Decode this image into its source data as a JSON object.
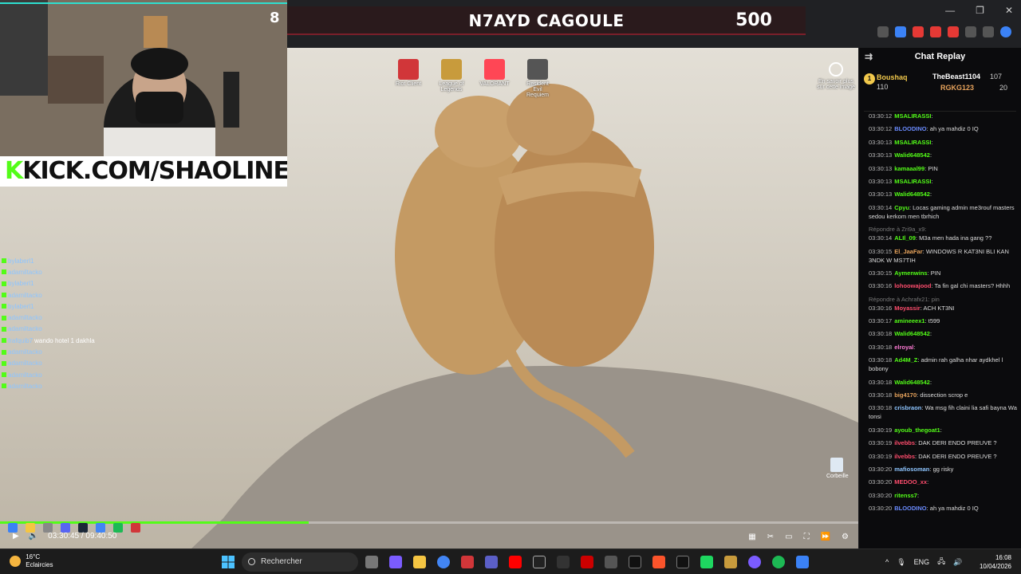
{
  "banner": {
    "title": "N7AYD CAGOULE",
    "score": "500"
  },
  "browser": {
    "url_hint": "4b510713"
  },
  "webcam": {
    "overlay_text": "KICK.COM/SHAOLINE",
    "overlay_k": "K",
    "rank": "8"
  },
  "desktop": {
    "icons": [
      {
        "label": "Riot Client",
        "color": "#d13639"
      },
      {
        "label": "League of Legends",
        "color": "#c89b3c"
      },
      {
        "label": "VALORANT",
        "color": "#ff4655"
      },
      {
        "label": "Resident Evil Requiem",
        "color": "#555555"
      }
    ],
    "corner_label": "En savoir plus sur cette image",
    "recycle_label": "Corbeille"
  },
  "overlay_chat": [
    {
      "name": "bylaberl1",
      "text": ""
    },
    {
      "name": "adamiltacko",
      "text": ""
    },
    {
      "name": "bylaberl1",
      "text": ""
    },
    {
      "name": "adamiltacko",
      "text": ""
    },
    {
      "name": "bylaberl1",
      "text": ""
    },
    {
      "name": "adamiltacko",
      "text": ""
    },
    {
      "name": "adamiltacko",
      "text": ""
    },
    {
      "name": "frafquib7",
      "text": "wando hotel 1 dakhla"
    },
    {
      "name": "adamiltacko",
      "text": ""
    },
    {
      "name": "adamiltacko",
      "text": ""
    },
    {
      "name": "adamiltacko",
      "text": ""
    },
    {
      "name": "adamiltacko",
      "text": ""
    }
  ],
  "player": {
    "time": "03:30:45 / 09:40:50",
    "progress": 0.36
  },
  "chat": {
    "title": "Chat Replay",
    "gifters": [
      {
        "name": "Boushaq",
        "amount": "110"
      },
      {
        "name": "TheBeast1104",
        "amount": "107"
      },
      {
        "name": "RGKG123",
        "amount": "20"
      }
    ],
    "messages": [
      {
        "time": "03:30:12",
        "user": "MSALIRASSI",
        "color": "#53fc18",
        "text": ""
      },
      {
        "time": "03:30:12",
        "user": "BLOODINO",
        "color": "#6b8cff",
        "text": "ah ya mahdiz 0 IQ"
      },
      {
        "time": "03:30:13",
        "user": "MSALIRASSI",
        "color": "#53fc18",
        "text": ""
      },
      {
        "time": "03:30:13",
        "user": "Walid648542",
        "color": "#53fc18",
        "text": ""
      },
      {
        "time": "03:30:13",
        "user": "kamaaal99",
        "color": "#53fc18",
        "text": "PIN"
      },
      {
        "time": "03:30:13",
        "user": "MSALIRASSI",
        "color": "#53fc18",
        "text": ""
      },
      {
        "time": "03:30:13",
        "user": "Walid648542",
        "color": "#53fc18",
        "text": ""
      },
      {
        "time": "03:30:14",
        "user": "Cpyu",
        "color": "#53fc18",
        "text": "Locas gaming admin me3rouf masters sedou kerkom men tbrhich"
      },
      {
        "time": "03:30:14",
        "user": "ALIl_09",
        "color": "#53fc18",
        "text": "M3a men hada ina gang ??",
        "reply": "Répondre à Zri9a_x9:"
      },
      {
        "time": "03:30:15",
        "user": "El_JaaFar",
        "color": "#e7a35c",
        "text": "WINDOWS R KAT3NI BLI KAN 3NDK W MS7TIH"
      },
      {
        "time": "03:30:15",
        "user": "Aymenwins",
        "color": "#53fc18",
        "text": "PIN"
      },
      {
        "time": "03:30:16",
        "user": "lohoowajood",
        "color": "#ff4d6d",
        "text": "Ta fin gal chi masters? Hhhh"
      },
      {
        "time": "03:30:16",
        "user": "Moyassir",
        "color": "#ff4d6d",
        "text": "ACH KT3NI",
        "reply": "Répondre à Achrafx21: pin"
      },
      {
        "time": "03:30:17",
        "user": "amineeex1",
        "color": "#53fc18",
        "text": "t599"
      },
      {
        "time": "03:30:18",
        "user": "Walid648542",
        "color": "#53fc18",
        "text": ""
      },
      {
        "time": "03:30:18",
        "user": "elroyal",
        "color": "#ff7bd5",
        "text": ""
      },
      {
        "time": "03:30:18",
        "user": "Ad4M_Z",
        "color": "#53fc18",
        "text": "admin rah galha nhar aydkhel l bobony"
      },
      {
        "time": "03:30:18",
        "user": "Walid648542",
        "color": "#53fc18",
        "text": ""
      },
      {
        "time": "03:30:18",
        "user": "big4170",
        "color": "#e7a35c",
        "text": "dissection scrop e"
      },
      {
        "time": "03:30:18",
        "user": "crisbraon",
        "color": "#8ec5ff",
        "text": "Wa msg fih claini lia safi bayna Wa tonsi"
      },
      {
        "time": "03:30:19",
        "user": "ayoub_thegoat1",
        "color": "#53fc18",
        "text": ""
      },
      {
        "time": "03:30:19",
        "user": "ilvebbs",
        "color": "#ff4d6d",
        "text": "DAK DERI ENDO PREUVE ?"
      },
      {
        "time": "03:30:19",
        "user": "ilvebbs",
        "color": "#ff4d6d",
        "text": "DAK DERI ENDO PREUVE ?"
      },
      {
        "time": "03:30:20",
        "user": "mafiosoman",
        "color": "#8ec5ff",
        "text": "gg risky"
      },
      {
        "time": "03:30:20",
        "user": "MEDOO_xx",
        "color": "#ff4d6d",
        "text": ""
      },
      {
        "time": "03:30:20",
        "user": "ritenss7",
        "color": "#53fc18",
        "text": ""
      },
      {
        "time": "03:30:20",
        "user": "BLOODINO",
        "color": "#6b8cff",
        "text": "ah ya mahdiz 0 IQ"
      }
    ]
  },
  "taskbar": {
    "weather_temp": "16°C",
    "weather_desc": "Eclaircies",
    "search_placeholder": "Rechercher",
    "lang": "ENG",
    "time": "16:08",
    "date": "10/04/2026"
  },
  "icons": {
    "search": "search-icon",
    "start": "windows-start-icon",
    "menu": "menu-icon"
  },
  "colors": {
    "kick_green": "#53fc18",
    "banner_bg": "#2a1a1c",
    "chat_bg": "#0b0b0d"
  }
}
